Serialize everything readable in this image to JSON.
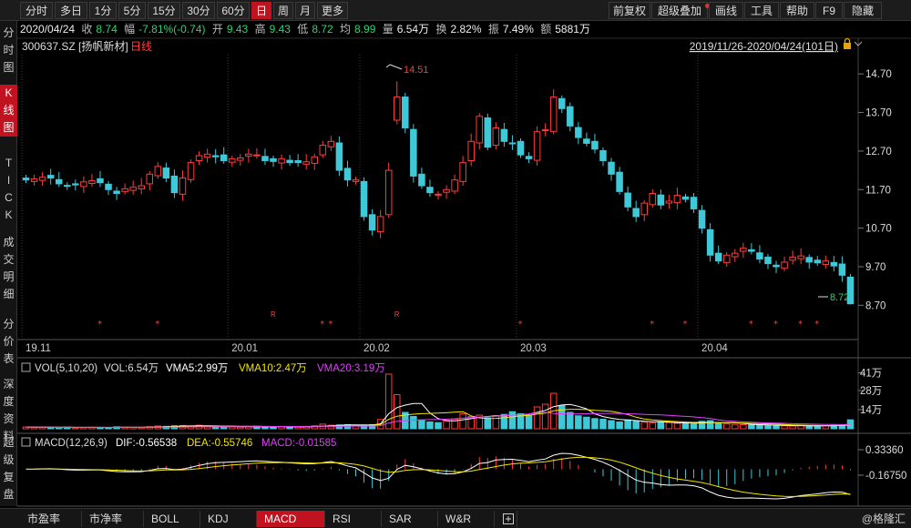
{
  "toolbar": {
    "left": [
      {
        "label": "分时",
        "active": false
      },
      {
        "label": "多日",
        "active": false
      },
      {
        "label": "1分",
        "active": false
      },
      {
        "label": "5分",
        "active": false
      },
      {
        "label": "15分",
        "active": false
      },
      {
        "label": "30分",
        "active": false
      },
      {
        "label": "60分",
        "active": false
      },
      {
        "label": "日",
        "active": true
      },
      {
        "label": "周",
        "active": false
      },
      {
        "label": "月",
        "active": false
      },
      {
        "label": "更多",
        "active": false
      }
    ],
    "right": [
      "前复权",
      "超级叠加",
      "画线",
      "工具",
      "帮助",
      "F9",
      "隐藏"
    ]
  },
  "quote": {
    "date": "2020/04/24",
    "close_label": "收",
    "close": "8.74",
    "change_label": "幅",
    "change": "-7.81%(-0.74)",
    "open_label": "开",
    "open": "9.43",
    "high_label": "高",
    "high": "9.43",
    "low_label": "低",
    "low": "8.72",
    "avg_label": "均",
    "avg": "8.99",
    "volume_label": "量",
    "volume": "6.54万",
    "turnover_label": "换",
    "turnover": "2.82%",
    "amplitude_label": "振",
    "amplitude": "7.49%",
    "amount_label": "额",
    "amount": "5881万"
  },
  "sidebar": [
    {
      "label": "分时图",
      "active": false
    },
    {
      "label": "K线图",
      "active": true
    },
    {
      "label": "TICK",
      "active": false
    },
    {
      "label": "成交明细",
      "active": false
    },
    {
      "label": "分价表",
      "active": false
    },
    {
      "label": "深度资料",
      "active": false
    },
    {
      "label": "超级复盘",
      "active": false
    }
  ],
  "chart_data": {
    "type": "candlestick",
    "stock_code": "300637.SZ",
    "stock_name": "[扬帆新材]",
    "period": "日线",
    "range": "2019/11/26-2020/04/24(101日)",
    "y_ticks": [
      14.7,
      13.7,
      12.7,
      11.7,
      10.7,
      9.7,
      8.7
    ],
    "ylim": [
      8.0,
      15.2
    ],
    "x_labels": [
      {
        "label": "19.11",
        "index": 0
      },
      {
        "label": "20.01",
        "index": 25
      },
      {
        "label": "20.02",
        "index": 41
      },
      {
        "label": "20.03",
        "index": 60
      },
      {
        "label": "20.04",
        "index": 82
      }
    ],
    "annotation_high": "14.51",
    "annotation_low": "8.72",
    "closes": [
      11.95,
      11.98,
      12.02,
      12.0,
      11.85,
      11.8,
      11.82,
      11.9,
      11.93,
      11.88,
      11.7,
      11.6,
      11.72,
      11.76,
      11.8,
      12.1,
      12.3,
      12.0,
      11.62,
      12.0,
      12.4,
      12.58,
      12.62,
      12.55,
      12.45,
      12.5,
      12.52,
      12.62,
      12.6,
      12.45,
      12.43,
      12.5,
      12.4,
      12.4,
      12.42,
      12.55,
      12.85,
      12.95,
      12.2,
      11.95,
      11.95,
      11.0,
      10.65,
      11.0,
      12.2,
      14.1,
      13.3,
      12.05,
      11.8,
      11.62,
      11.58,
      11.7,
      11.95,
      12.4,
      12.95,
      13.6,
      12.8,
      13.3,
      12.95,
      12.9,
      12.6,
      12.5,
      13.2,
      13.25,
      14.1,
      13.8,
      13.35,
      13.05,
      12.9,
      12.75,
      12.45,
      12.1,
      11.65,
      11.25,
      11.0,
      11.35,
      11.6,
      11.3,
      11.4,
      11.55,
      11.45,
      11.2,
      10.7,
      10.0,
      9.85,
      10.0,
      10.05,
      10.18,
      10.1,
      9.9,
      9.78,
      9.7,
      9.82,
      9.95,
      9.98,
      9.82,
      9.8,
      9.85,
      9.72,
      9.48,
      8.74
    ],
    "volume": {
      "label": "VOL(5,10,20)",
      "vol": "VOL:6.54万",
      "vma5": "VMA5:2.99万",
      "vma10": "VMA10:2.47万",
      "vma20": "VMA20:3.19万",
      "ticks": [
        "41万",
        "28万",
        "14万"
      ],
      "values": [
        1.3,
        1.1,
        1.2,
        0.9,
        1.0,
        1.2,
        0.8,
        1.0,
        1.1,
        0.9,
        1.0,
        1.4,
        1.1,
        1.0,
        0.9,
        1.5,
        2.0,
        1.8,
        2.2,
        2.4,
        2.0,
        2.6,
        1.8,
        1.6,
        1.5,
        1.4,
        1.2,
        1.6,
        1.8,
        1.5,
        1.6,
        1.7,
        1.4,
        1.3,
        1.4,
        2.2,
        3.4,
        2.6,
        2.8,
        3.0,
        2.5,
        2.8,
        3.0,
        6.8,
        40.0,
        25.0,
        12.0,
        9.0,
        6.5,
        5.0,
        4.5,
        5.5,
        7.0,
        11.0,
        9.0,
        10.0,
        8.0,
        9.5,
        10.5,
        12.5,
        11.0,
        10.0,
        16.0,
        18.0,
        26.0,
        17.0,
        12.0,
        9.5,
        8.5,
        7.5,
        7.0,
        6.0,
        5.0,
        6.5,
        5.5,
        4.8,
        4.2,
        5.0,
        4.6,
        4.0,
        3.8,
        3.5,
        5.5,
        6.0,
        4.0,
        3.5,
        3.2,
        3.0,
        2.8,
        2.6,
        2.5,
        2.4,
        2.2,
        2.0,
        2.3,
        2.1,
        2.0,
        2.2,
        2.6,
        3.0,
        6.54
      ]
    },
    "macd": {
      "label": "MACD(12,26,9)",
      "dif": "DIF:-0.56538",
      "dea": "DEA:-0.55746",
      "macd": "MACD:-0.01585",
      "ticks": [
        "0.33360",
        "-0.16750"
      ]
    }
  },
  "bottom_tabs": [
    {
      "label": "市盈率",
      "active": false
    },
    {
      "label": "市净率",
      "active": false
    },
    {
      "label": "BOLL",
      "active": false
    },
    {
      "label": "KDJ",
      "active": false
    },
    {
      "label": "MACD",
      "active": true
    },
    {
      "label": "RSI",
      "active": false
    },
    {
      "label": "SAR",
      "active": false
    },
    {
      "label": "W&R",
      "active": false
    }
  ],
  "brand": "@格隆汇",
  "colors": {
    "up": "#ff3b3b",
    "down": "#3ec8d8",
    "accent": "#c1121f",
    "vma5": "#ffffff",
    "vma10": "#f2e600",
    "vma20": "#e040fb"
  }
}
